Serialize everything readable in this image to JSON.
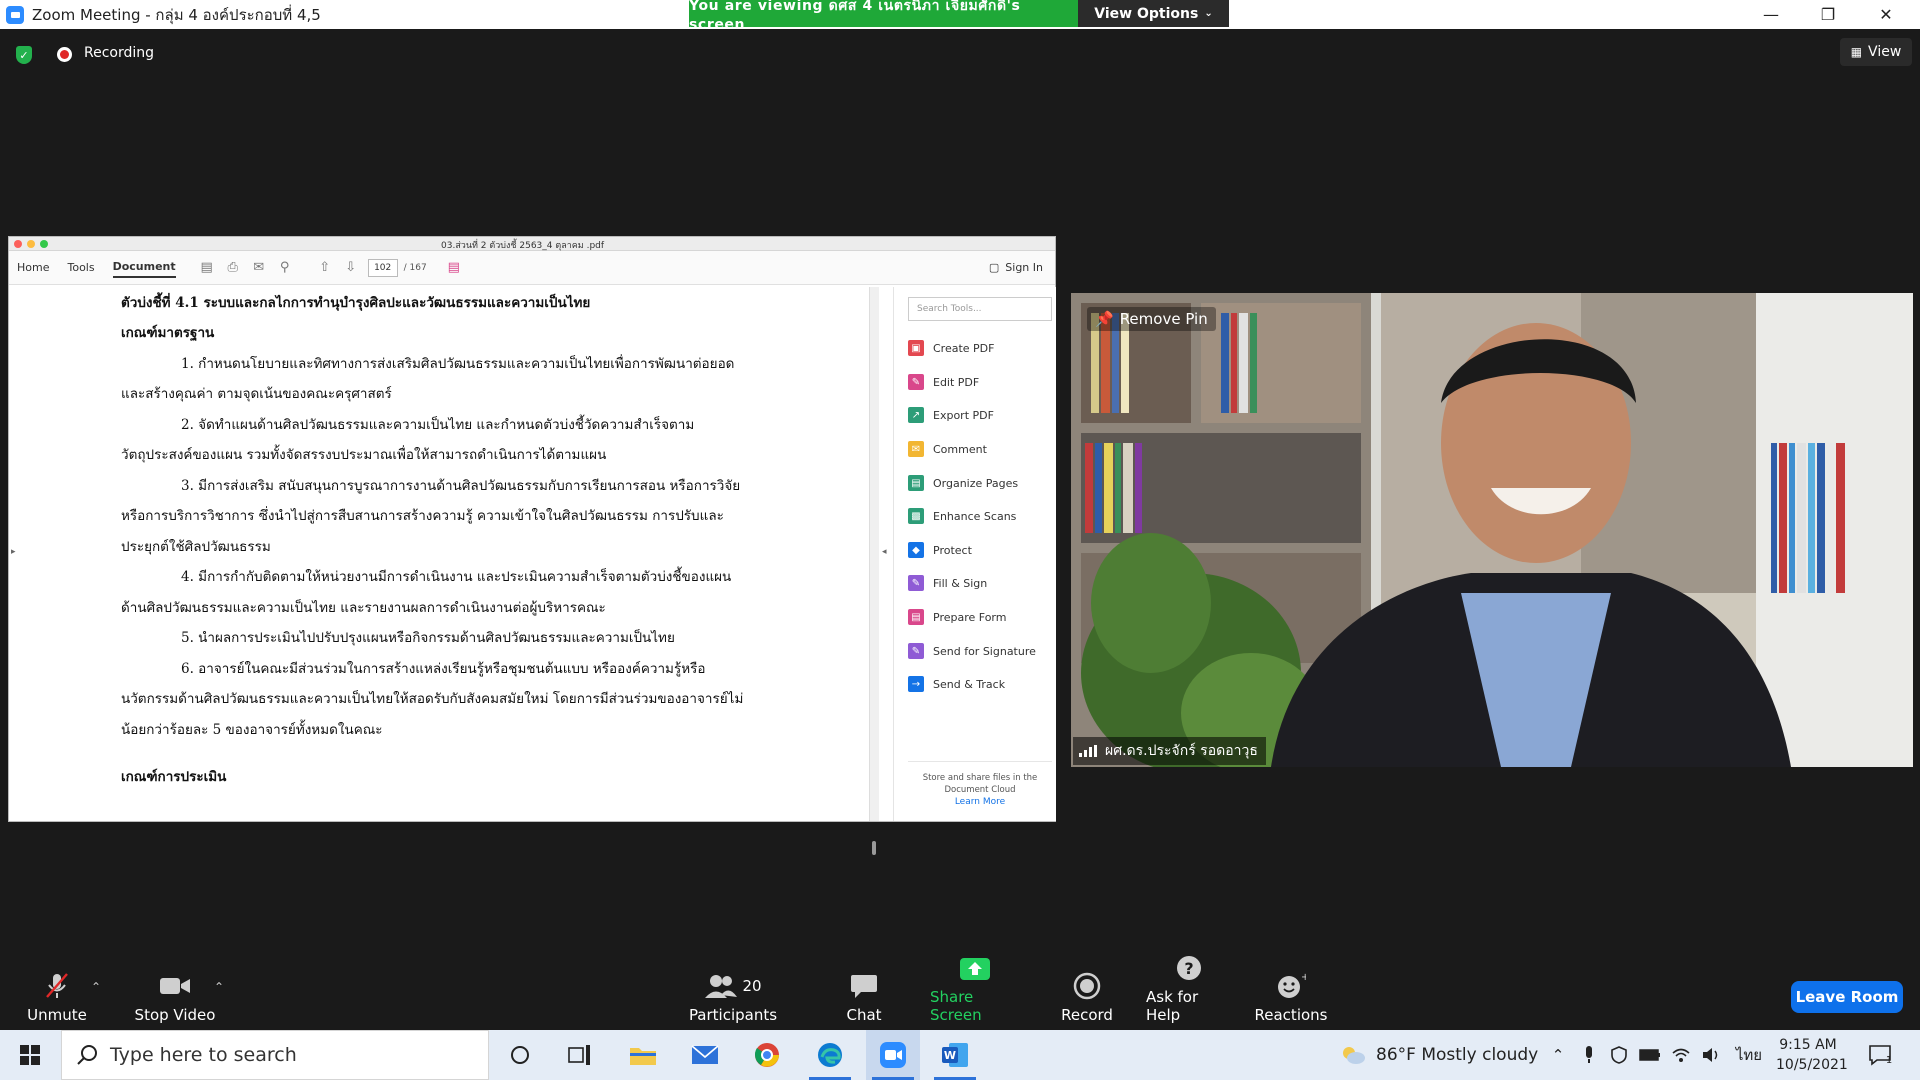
{
  "window": {
    "title": "Zoom Meeting - กลุ่ม 4 องค์ประกอบที่ 4,5",
    "viewing_banner": "You are viewing ดศส 4 เนตรนิภา เจียมศักดิ์'s screen",
    "view_options": "View Options"
  },
  "meeting_bar": {
    "recording_label": "Recording",
    "view_label": "View"
  },
  "pdf": {
    "filename": "03.ส่วนที่ 2 ตัวบ่งชี้ 2563_4 ตุลาคม .pdf",
    "tabs": [
      "Home",
      "Tools",
      "Document"
    ],
    "active_tab": "Document",
    "page_current": "102",
    "page_total": "/ 167",
    "sign_in": "Sign In",
    "search_tools_placeholder": "Search Tools...",
    "tools": [
      {
        "label": "Create PDF",
        "color": "#e34850",
        "icon": "create-pdf-icon"
      },
      {
        "label": "Edit PDF",
        "color": "#d9478b",
        "icon": "edit-pdf-icon"
      },
      {
        "label": "Export PDF",
        "color": "#2d9d78",
        "icon": "export-pdf-icon"
      },
      {
        "label": "Comment",
        "color": "#f2b632",
        "icon": "comment-icon"
      },
      {
        "label": "Organize Pages",
        "color": "#2d9d78",
        "icon": "organize-pages-icon"
      },
      {
        "label": "Enhance Scans",
        "color": "#2d9d78",
        "icon": "enhance-scans-icon"
      },
      {
        "label": "Protect",
        "color": "#1473e6",
        "icon": "protect-icon"
      },
      {
        "label": "Fill & Sign",
        "color": "#8f5bd5",
        "icon": "fill-sign-icon"
      },
      {
        "label": "Prepare Form",
        "color": "#d9478b",
        "icon": "prepare-form-icon"
      },
      {
        "label": "Send for Signature",
        "color": "#8f5bd5",
        "icon": "send-signature-icon"
      },
      {
        "label": "Send & Track",
        "color": "#1473e6",
        "icon": "send-track-icon"
      }
    ],
    "cloud_note": "Store and share files in the Document Cloud",
    "learn_more": "Learn More",
    "doc_lines": [
      {
        "text": "ตัวบ่งชี้ที่ 4.1 ระบบและกลไกการทำนุบำรุงศิลปะและวัฒนธรรมและความเป็นไทย",
        "bold": true
      },
      {
        "text": "เกณฑ์มาตรฐาน",
        "bold": true
      },
      {
        "text": "1. กำหนดนโยบายและทิศทางการส่งเสริมศิลปวัฒนธรรมและความเป็นไทยเพื่อการพัฒนาต่อยอด",
        "bold": false
      },
      {
        "text": "และสร้างคุณค่า ตามจุดเน้นของคณะครุศาสตร์",
        "bold": false
      },
      {
        "text": "2. จัดทำแผนด้านศิลปวัฒนธรรมและความเป็นไทย และกำหนดตัวบ่งชี้วัดความสำเร็จตาม",
        "bold": false
      },
      {
        "text": "วัตถุประสงค์ของแผน รวมทั้งจัดสรรงบประมาณเพื่อให้สามารถดำเนินการได้ตามแผน",
        "bold": false
      },
      {
        "text": "3. มีการส่งเสริม สนับสนุนการบูรณาการงานด้านศิลปวัฒนธรรมกับการเรียนการสอน หรือการวิจัย",
        "bold": false
      },
      {
        "text": "หรือการบริการวิชาการ ซึ่งนำไปสู่การสืบสานการสร้างความรู้ ความเข้าใจในศิลปวัฒนธรรม การปรับและ",
        "bold": false
      },
      {
        "text": "ประยุกต์ใช้ศิลปวัฒนธรรม",
        "bold": false
      },
      {
        "text": "4. มีการกำกับติดตามให้หน่วยงานมีการดำเนินงาน และประเมินความสำเร็จตามตัวบ่งชี้ของแผน",
        "bold": false
      },
      {
        "text": "ด้านศิลปวัฒนธรรมและความเป็นไทย และรายงานผลการดำเนินงานต่อผู้บริหารคณะ",
        "bold": false
      },
      {
        "text": "5. นำผลการประเมินไปปรับปรุงแผนหรือกิจกรรมด้านศิลปวัฒนธรรมและความเป็นไทย",
        "bold": false
      },
      {
        "text": "6. อาจารย์ในคณะมีส่วนร่วมในการสร้างแหล่งเรียนรู้หรือชุมชนต้นแบบ หรือองค์ความรู้หรือ",
        "bold": false
      },
      {
        "text": "นวัตกรรมด้านศิลปวัฒนธรรมและความเป็นไทยให้สอดรับกับสังคมสมัยใหม่ โดยการมีส่วนร่วมของอาจารย์ไม่",
        "bold": false
      },
      {
        "text": "น้อยกว่าร้อยละ 5 ของอาจารย์ทั้งหมดในคณะ",
        "bold": false
      },
      {
        "text": "เกณฑ์การประเมิน",
        "bold": true
      }
    ]
  },
  "video": {
    "remove_pin": "Remove Pin",
    "participant_name": "ผศ.ดร.ประจักร์ รอดอาวุธ"
  },
  "toolbar": {
    "unmute": "Unmute",
    "stop_video": "Stop Video",
    "participants": "Participants",
    "participants_count": "20",
    "chat": "Chat",
    "share_screen": "Share Screen",
    "record": "Record",
    "ask_for_help": "Ask for Help",
    "reactions": "Reactions",
    "leave_room": "Leave Room"
  },
  "taskbar": {
    "search_placeholder": "Type here to search",
    "weather": "86°F  Mostly cloudy",
    "language": "ไทย",
    "time": "9:15 AM",
    "date": "10/5/2021",
    "notification_count": "1"
  },
  "colors": {
    "banner_green": "#1fa838",
    "share_green": "#23d160",
    "leave_blue": "#0e71eb"
  }
}
